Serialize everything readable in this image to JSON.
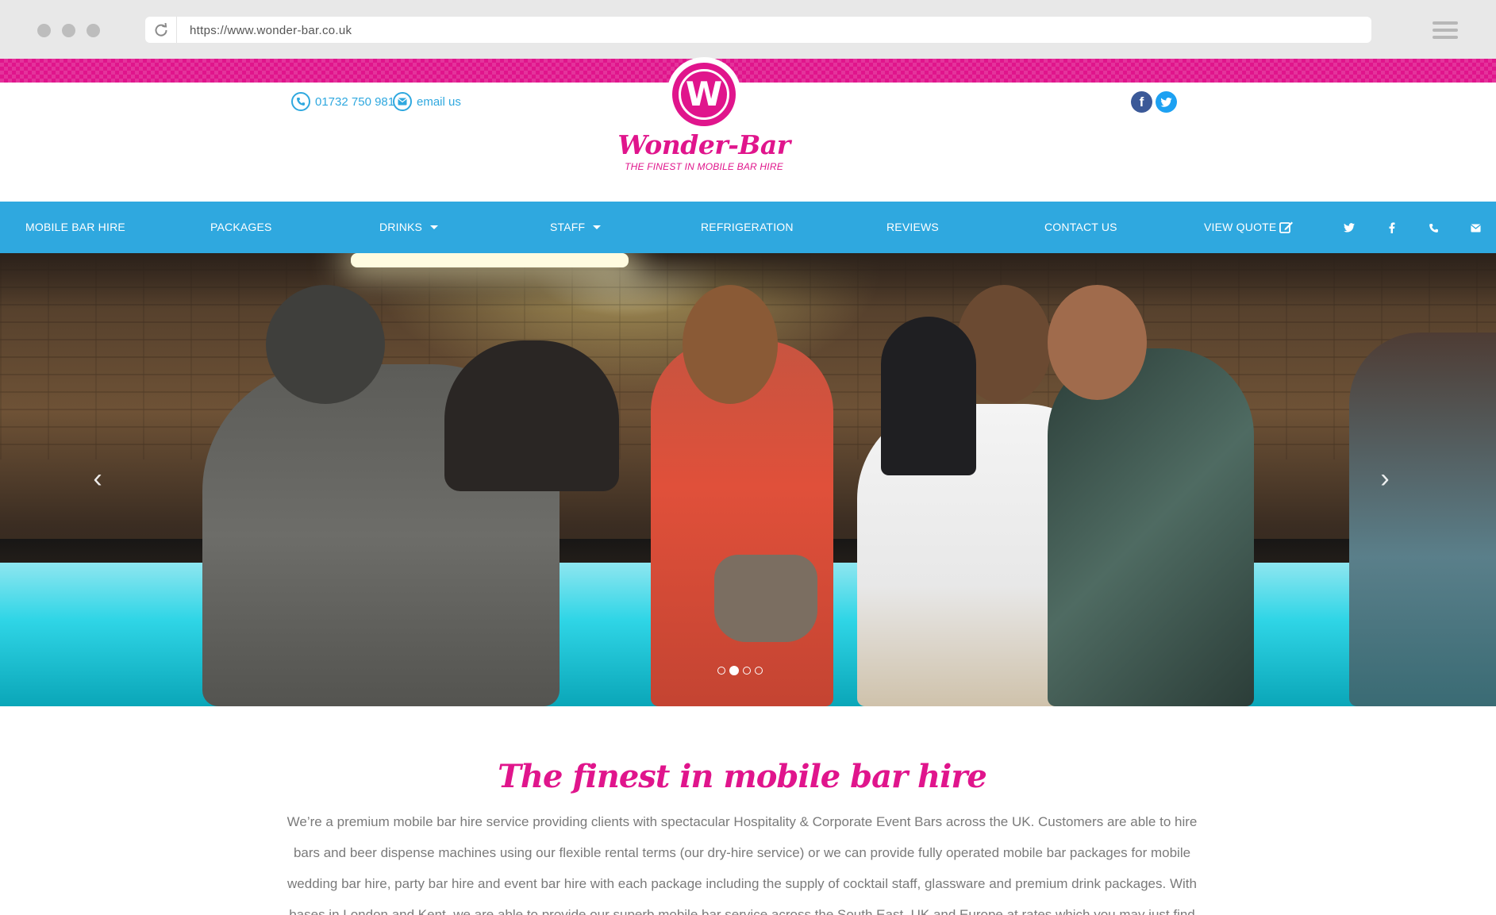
{
  "browser": {
    "url": "https://www.wonder-bar.co.uk"
  },
  "header": {
    "phone": "01732 750 981",
    "email_label": "email us",
    "logo_letter": "W",
    "brand_name": "Wonder-Bar",
    "tagline": "THE FINEST IN MOBILE BAR HIRE",
    "social_facebook": "f",
    "social_twitter": "t"
  },
  "nav": {
    "items": [
      {
        "label": "MOBILE BAR HIRE"
      },
      {
        "label": "PACKAGES"
      },
      {
        "label": "DRINKS"
      },
      {
        "label": "STAFF"
      },
      {
        "label": "REFRIGERATION"
      },
      {
        "label": "REVIEWS"
      },
      {
        "label": "CONTACT US"
      },
      {
        "label": "VIEW QUOTE"
      }
    ],
    "icons": [
      "twitter-icon",
      "facebook-icon",
      "phone-icon",
      "envelope-icon"
    ]
  },
  "carousel": {
    "slide_count": 4,
    "active_index": 1,
    "prev_glyph": "‹",
    "next_glyph": "›"
  },
  "intro": {
    "title": "The finest in mobile bar hire",
    "body": "We’re a premium mobile bar hire service providing clients with spectacular Hospitality & Corporate Event Bars across the UK. Customers are able to hire bars and beer dispense machines using our flexible rental terms (our dry-hire service) or we can provide fully operated mobile bar packages for mobile wedding bar hire, party bar hire and event bar hire with each package including the supply of cocktail staff, glassware and premium drink packages. With bases in London and Kent, we are able to provide our superb mobile bar service across the South East, UK and Europe at rates which you may just find"
  },
  "colors": {
    "brand_pink": "#e0158c",
    "nav_blue": "#2fa8df",
    "body_text": "#7a7a7a"
  }
}
